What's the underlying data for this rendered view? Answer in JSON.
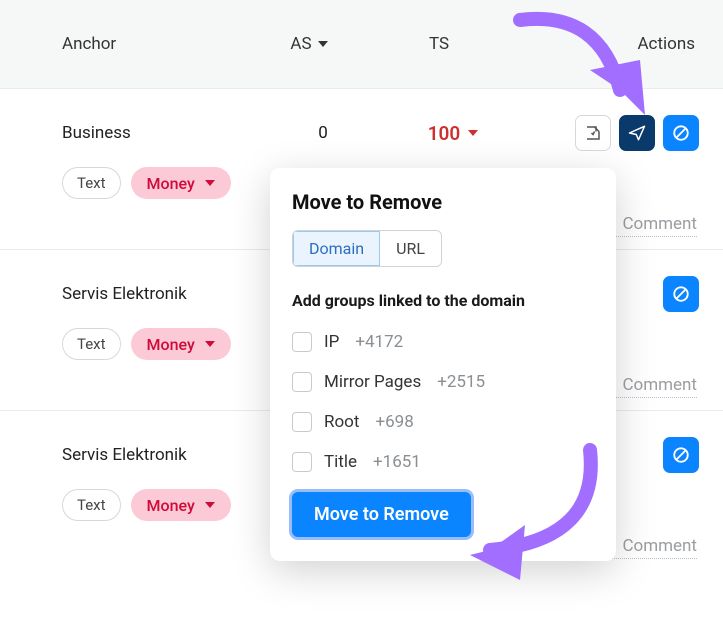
{
  "header": {
    "anchor": "Anchor",
    "as": "AS",
    "ts": "TS",
    "actions": "Actions"
  },
  "rows": [
    {
      "anchor": "Business",
      "as": "0",
      "ts": "100",
      "text_pill": "Text",
      "money_pill": "Money",
      "comment": "Comment"
    },
    {
      "anchor": "Servis Elektronik",
      "as": "",
      "ts": "",
      "text_pill": "Text",
      "money_pill": "Money",
      "comment": "Comment"
    },
    {
      "anchor": "Servis Elektronik",
      "as": "",
      "ts": "",
      "text_pill": "Text",
      "money_pill": "Money",
      "comment": "Comment"
    }
  ],
  "popover": {
    "title": "Move to Remove",
    "seg_domain": "Domain",
    "seg_url": "URL",
    "group_head": "Add groups linked to the domain",
    "options": [
      {
        "label": "IP",
        "count": "+4172"
      },
      {
        "label": "Mirror Pages",
        "count": "+2515"
      },
      {
        "label": "Root",
        "count": "+698"
      },
      {
        "label": "Title",
        "count": "+1651"
      }
    ],
    "button": "Move to Remove"
  }
}
